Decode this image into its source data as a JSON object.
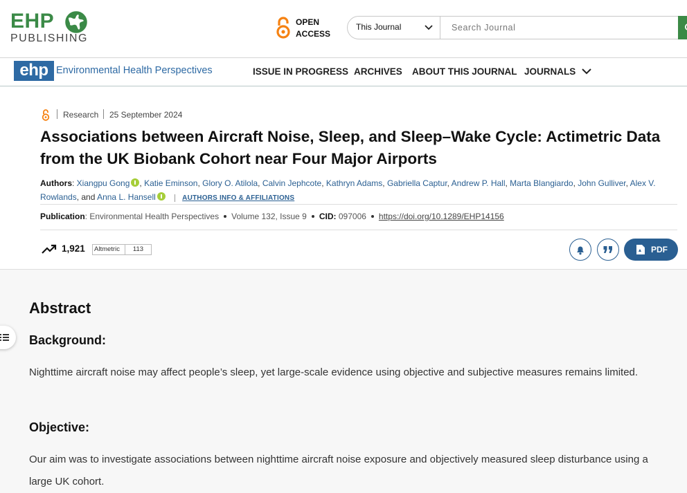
{
  "header": {
    "logo_main": "EHP",
    "logo_sub": "PUBLISHING",
    "open_access_line1": "OPEN",
    "open_access_line2": "ACCESS",
    "search_scope": "This Journal",
    "search_placeholder": "Search Journal"
  },
  "nav": {
    "journal_abbrev": "ehp",
    "journal_name": "Environmental Health Perspectives",
    "items": [
      "ISSUE IN PROGRESS",
      "ARCHIVES",
      "ABOUT THIS JOURNAL",
      "JOURNALS"
    ]
  },
  "article": {
    "type": "Research",
    "date": "25 September 2024",
    "title": "Associations between Aircraft Noise, Sleep, and Sleep–Wake Cycle: Actimetric Data from the UK Biobank Cohort near Four Major Airports",
    "authors_label": "Authors",
    "authors": [
      "Xiangpu Gong",
      "Katie Eminson",
      "Glory O. Atilola",
      "Calvin Jephcote",
      "Kathryn Adams",
      "Gabriella Captur",
      "Andrew P. Hall",
      "Marta Blangiardo",
      "John Gulliver",
      "Alex V. Rowlands",
      "Anna L. Hansell"
    ],
    "and_text": "and",
    "affiliations_link": "AUTHORS INFO & AFFILIATIONS",
    "publication_label": "Publication",
    "publication": "Environmental Health Perspectives",
    "volume": "Volume 132, Issue 9",
    "cid_label": "CID:",
    "cid": "097006",
    "doi": "https://doi.org/10.1289/EHP14156",
    "views": "1,921",
    "altmetric_label": "Altmetric",
    "altmetric_score": "113",
    "pdf_label": "PDF"
  },
  "abstract": {
    "heading": "Abstract",
    "background_heading": "Background:",
    "background_text": "Nighttime aircraft noise may affect people’s sleep, yet large-scale evidence using objective and subjective measures remains limited.",
    "objective_heading": "Objective:",
    "objective_text": "Our aim was to investigate associations between nighttime aircraft noise exposure and objectively measured sleep disturbance using a large UK cohort."
  },
  "colors": {
    "brand_green": "#3b8a47",
    "brand_blue": "#2e6aa4",
    "link_blue": "#2a5f92",
    "open_access_orange": "#f68212",
    "orcid_green": "#a6ce39"
  }
}
